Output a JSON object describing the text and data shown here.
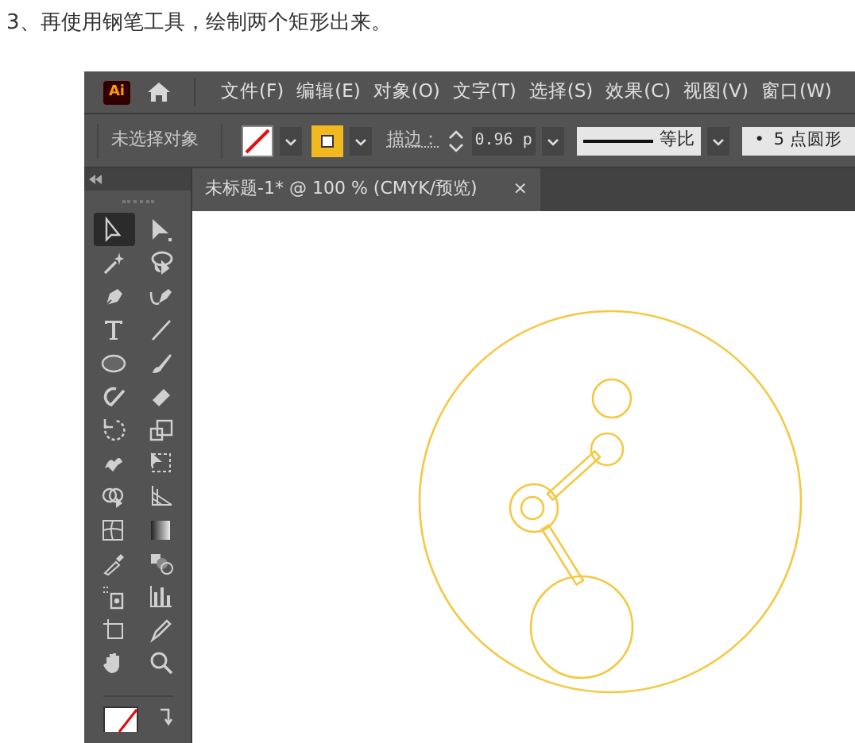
{
  "caption": "3、再使用钢笔工具，绘制两个矩形出来。",
  "app": {
    "logo": "Ai",
    "menu": [
      "文件(F)",
      "编辑(E)",
      "对象(O)",
      "文字(T)",
      "选择(S)",
      "效果(C)",
      "视图(V)",
      "窗口(W)"
    ],
    "control_bar": {
      "selection_status": "未选择对象",
      "stroke_label": "描边：",
      "stroke_weight": "0.96 p",
      "profile": "等比",
      "brush_dot": "•",
      "brush": "5 点圆形"
    },
    "document_tab": {
      "title": "未标题-1* @ 100 % (CMYK/预览)",
      "close": "×"
    },
    "tools": [
      {
        "kind": "selection",
        "selected": true
      },
      {
        "kind": "direct",
        "selected": false
      },
      {
        "kind": "wand",
        "selected": false
      },
      {
        "kind": "lasso",
        "selected": false
      },
      {
        "kind": "pen",
        "selected": false
      },
      {
        "kind": "curvature",
        "selected": false
      },
      {
        "kind": "type",
        "selected": false
      },
      {
        "kind": "line",
        "selected": false
      },
      {
        "kind": "ellipse",
        "selected": false
      },
      {
        "kind": "brush",
        "selected": false
      },
      {
        "kind": "shaper",
        "selected": false
      },
      {
        "kind": "eraser",
        "selected": false
      },
      {
        "kind": "rotate",
        "selected": false
      },
      {
        "kind": "scale",
        "selected": false
      },
      {
        "kind": "puppet",
        "selected": false
      },
      {
        "kind": "transform",
        "selected": false
      },
      {
        "kind": "builder",
        "selected": false
      },
      {
        "kind": "perspective",
        "selected": false
      },
      {
        "kind": "mesh",
        "selected": false
      },
      {
        "kind": "gradient",
        "selected": false
      },
      {
        "kind": "eyedropper",
        "selected": false
      },
      {
        "kind": "blend",
        "selected": false
      },
      {
        "kind": "sprayer",
        "selected": false
      },
      {
        "kind": "graph",
        "selected": false
      },
      {
        "kind": "artboard",
        "selected": false
      },
      {
        "kind": "knife",
        "selected": false
      },
      {
        "kind": "hand",
        "selected": false
      },
      {
        "kind": "zoom",
        "selected": false
      }
    ]
  }
}
